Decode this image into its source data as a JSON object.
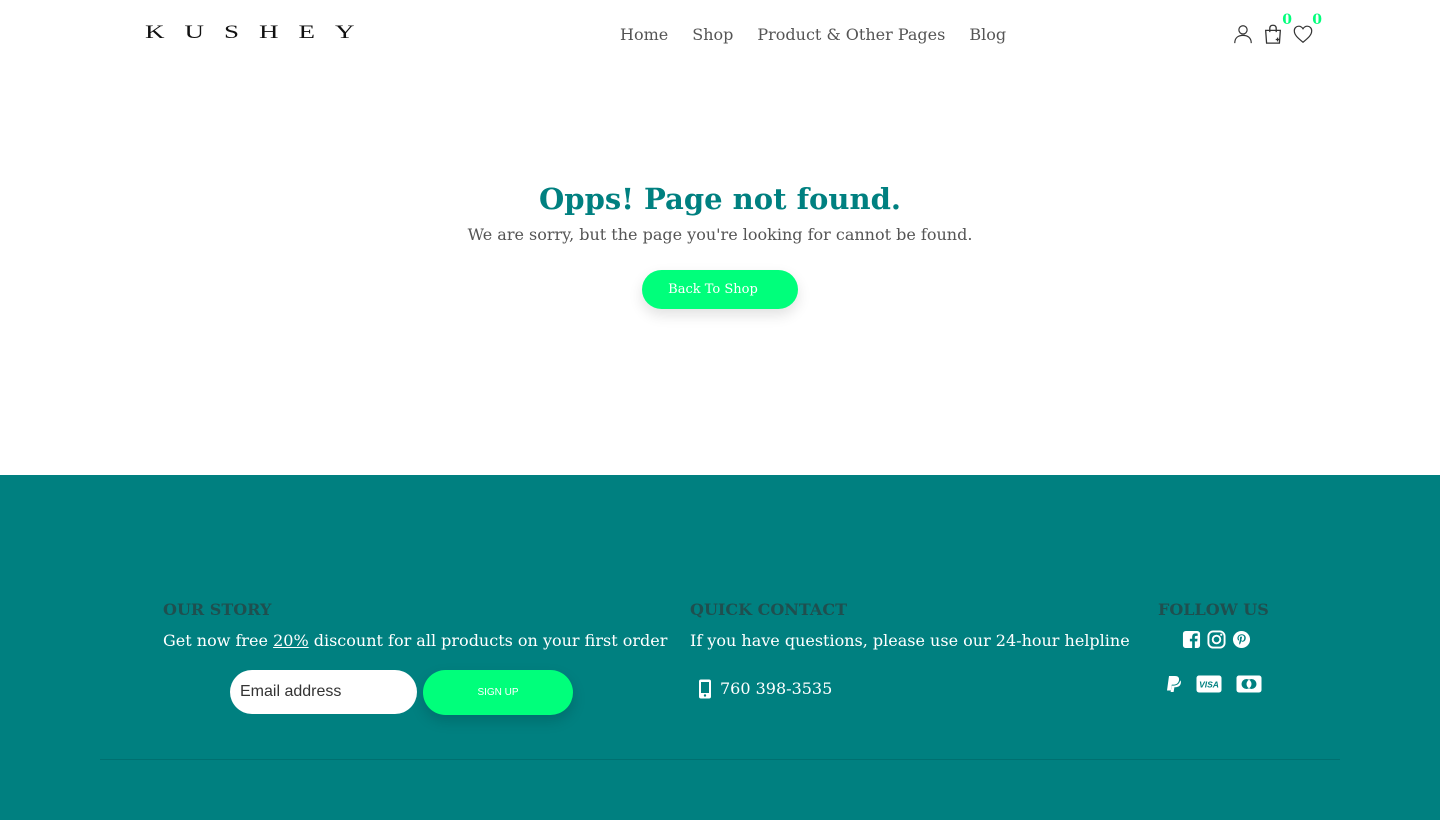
{
  "brand": {
    "logo_text": "KUSHEY"
  },
  "nav": {
    "items": [
      {
        "label": "Home"
      },
      {
        "label": "Shop"
      },
      {
        "label": "Product & Other Pages"
      },
      {
        "label": "Blog"
      }
    ]
  },
  "header_icons": {
    "account": {
      "icon": "user-icon"
    },
    "cart": {
      "icon": "shopping-bag-icon",
      "count": "0"
    },
    "wishlist": {
      "icon": "heart-icon",
      "count": "0"
    }
  },
  "error": {
    "title": "Opps! Page not found.",
    "message": "We are sorry, but the page you're looking for cannot be found.",
    "button_label": "Back To Shop"
  },
  "footer": {
    "our_story": {
      "heading": "OUR STORY",
      "text_before": "Get now free ",
      "discount": "20%",
      "text_after": " discount for all products on your first order",
      "email_placeholder": "Email address",
      "signup_label": "SIGN UP"
    },
    "quick_contact": {
      "heading": "QUICK CONTACT",
      "text": "If you have questions, please use our 24-hour helpline",
      "phone": "760 398-3535",
      "phone_icon": "mobile-phone-icon"
    },
    "follow_us": {
      "heading": "FOLLOW US",
      "social_icons": [
        "facebook-icon",
        "instagram-icon",
        "pinterest-icon"
      ],
      "payment_icons": [
        "paypal-icon",
        "visa-icon",
        "mastercard-icon"
      ]
    }
  },
  "colors": {
    "teal": "#008080",
    "accent_green": "#00ff7b",
    "text_grey": "#555555",
    "footer_heading": "#1f4f4f"
  }
}
